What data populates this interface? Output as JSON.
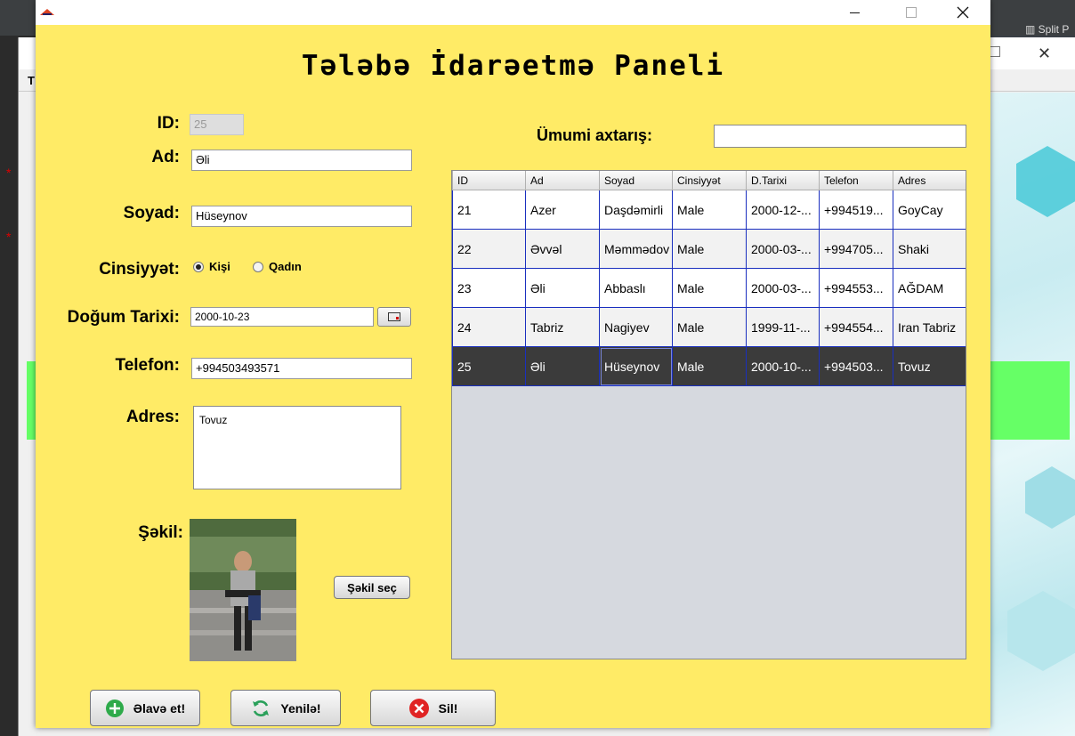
{
  "background": {
    "split_label": "Split P",
    "win2_title_initial": "T"
  },
  "window": {
    "title": "Tələbə İdarəetmə Paneli"
  },
  "form": {
    "id_label": "ID:",
    "id_value": "25",
    "name_label": "Ad:",
    "name_value": "Əli",
    "surname_label": "Soyad:",
    "surname_value": "Hüseynov",
    "gender_label": "Cinsiyyət:",
    "gender_options": [
      "Kişi",
      "Qadın"
    ],
    "gender_selected": "Kişi",
    "birth_label": "Doğum Tarixi:",
    "birth_value": "2000-10-23",
    "phone_label": "Telefon:",
    "phone_value": "+994503493571",
    "address_label": "Adres:",
    "address_value": "Tovuz",
    "photo_label": "Şəkil:",
    "photo_button": "Şəkil seç"
  },
  "search": {
    "label": "Ümumi axtarış:",
    "value": ""
  },
  "table": {
    "columns": [
      "ID",
      "Ad",
      "Soyad",
      "Cinsiyyət",
      "D.Tarixi",
      "Telefon",
      "Adres"
    ],
    "rows": [
      [
        "21",
        "Azer",
        "Daşdəmirli",
        "Male",
        "2000-12-...",
        "+994519...",
        "GoyCay"
      ],
      [
        "22",
        "Əvvəl",
        "Məmmədov",
        "Male",
        "2000-03-...",
        "+994705...",
        "Shaki"
      ],
      [
        "23",
        "Əli",
        "Abbaslı",
        "Male",
        "2000-03-...",
        "+994553...",
        "AĞDAM"
      ],
      [
        "24",
        "Tabriz",
        "Nagiyev",
        "Male",
        "1999-11-...",
        "+994554...",
        "Iran Tabriz"
      ],
      [
        "25",
        "Əli",
        "Hüseynov",
        "Male",
        "2000-10-...",
        "+994503...",
        "Tovuz"
      ]
    ],
    "selected_row_id": "25"
  },
  "actions": {
    "add_label": "Əlavə et!",
    "update_label": "Yenilə!",
    "delete_label": "Sil!"
  },
  "colors": {
    "window_bg": "#ffeb66",
    "selected_row": "#3b3b3b",
    "grid_line": "#1a2fbf",
    "add_icon": "#2eaa4a",
    "update_icon": "#2aa05a",
    "delete_icon": "#e02424"
  },
  "icons": {
    "add": "plus-circle-icon",
    "update": "refresh-icon",
    "delete": "close-circle-icon",
    "date": "calendar-icon"
  }
}
